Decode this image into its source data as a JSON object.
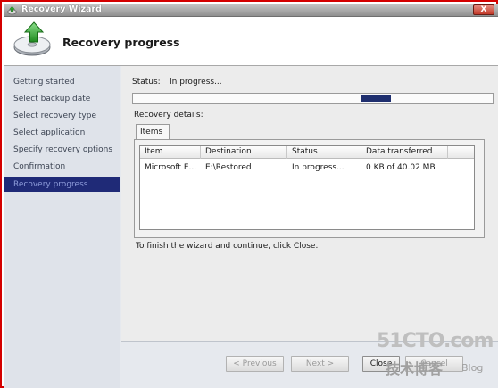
{
  "window": {
    "title": "Recovery Wizard",
    "close_glyph": "X"
  },
  "header": {
    "title": "Recovery progress",
    "icon": "backup-disk-arrow-icon"
  },
  "nav": {
    "items": [
      {
        "label": "Getting started"
      },
      {
        "label": "Select backup date"
      },
      {
        "label": "Select recovery type"
      },
      {
        "label": "Select application"
      },
      {
        "label": "Specify recovery options"
      },
      {
        "label": "Confirmation"
      },
      {
        "label": "Recovery progress",
        "active": true
      }
    ]
  },
  "status": {
    "label": "Status:",
    "value": "In progress..."
  },
  "progress": {
    "indeterminate_position": 0.69
  },
  "details": {
    "label": "Recovery details:"
  },
  "tabs": [
    {
      "label": "Items"
    }
  ],
  "table": {
    "columns": [
      "Item",
      "Destination",
      "Status",
      "Data transferred"
    ],
    "rows": [
      [
        "Microsoft E...",
        "E:\\Restored",
        "In progress...",
        "0 KB of 40.02 MB"
      ]
    ]
  },
  "finish_text": "To finish the wizard and continue, click Close.",
  "buttons": {
    "previous": "< Previous",
    "next": "Next >",
    "close": "Close",
    "cancel": "Cancel"
  },
  "watermark": {
    "line1": "51CTO.com",
    "line2": "技术博客",
    "line3": "Blog"
  },
  "colors": {
    "title_bar": "#a9a9a9",
    "nav_active_bg": "#1f2a77",
    "nav_active_text": "#8d9bd9",
    "progress_fill": "#1e2e6e",
    "frame": "#d40000"
  }
}
